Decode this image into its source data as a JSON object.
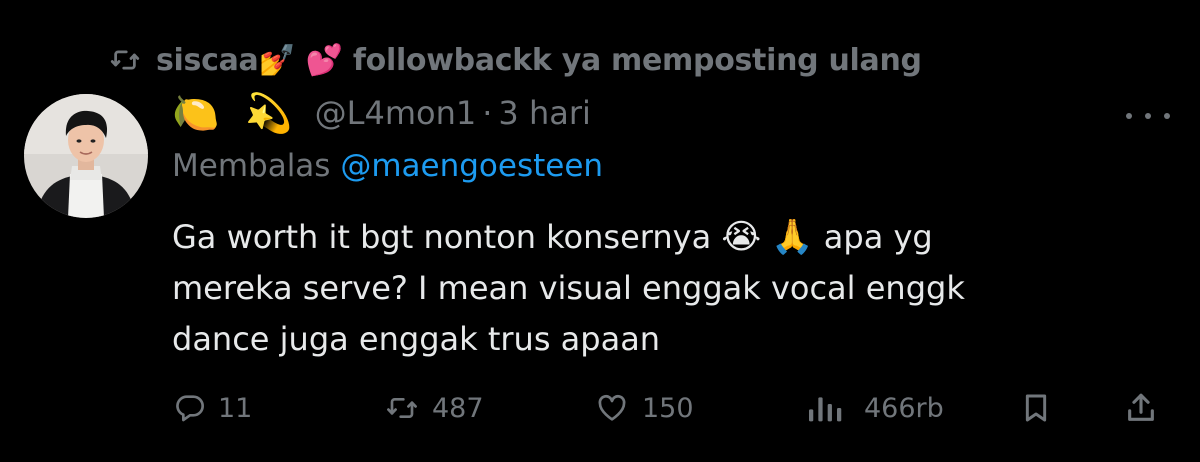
{
  "repost": {
    "icon": "repost-icon",
    "user": "siscaa",
    "emojis": [
      "💅",
      "💕"
    ],
    "text": "followbackk ya memposting ulang"
  },
  "post": {
    "avatar": "avatar",
    "name_emojis": [
      "🍋",
      "💫"
    ],
    "handle": "@L4mon1",
    "separator": "·",
    "time": "3 hari",
    "replying_prefix": "Membalas",
    "replying_to": "@maengoesteen",
    "body_lines": [
      "Ga worth it bgt nonton konsernya",
      "apa yg",
      "mereka serve? I mean visual enggak vocal enggk",
      "dance juga enggak trus apaan"
    ],
    "body_emojis": [
      "😭",
      "🙏"
    ]
  },
  "actions": {
    "reply_count": "11",
    "repost_count": "487",
    "like_count": "150",
    "views_count": "466rb"
  },
  "colors": {
    "background": "#000000",
    "text_primary": "#e7e9ea",
    "text_secondary": "#71767b",
    "link": "#1d9bf0"
  }
}
